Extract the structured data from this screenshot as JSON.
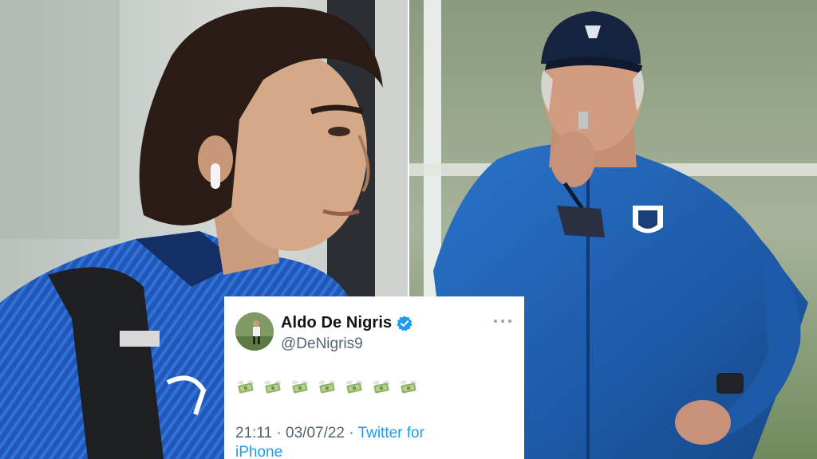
{
  "tweet": {
    "display_name": "Aldo De Nigris",
    "handle": "@DeNigris9",
    "body_emoji": [
      "money-with-wings",
      "money-with-wings",
      "money-with-wings",
      "money-with-wings",
      "money-with-wings",
      "money-with-wings",
      "money-with-wings"
    ],
    "time": "21:11",
    "separator": "·",
    "date": "03/07/22",
    "source": "Twitter for",
    "source_overflow": "iPhone",
    "icons": {
      "verified": "verified-badge-icon",
      "more": "more-options-icon"
    }
  },
  "colors": {
    "link_blue": "#1d9bf0",
    "verified_blue": "#1d9bf0",
    "kit_blue": "#1f5fb3",
    "cap_navy": "#15233f"
  }
}
